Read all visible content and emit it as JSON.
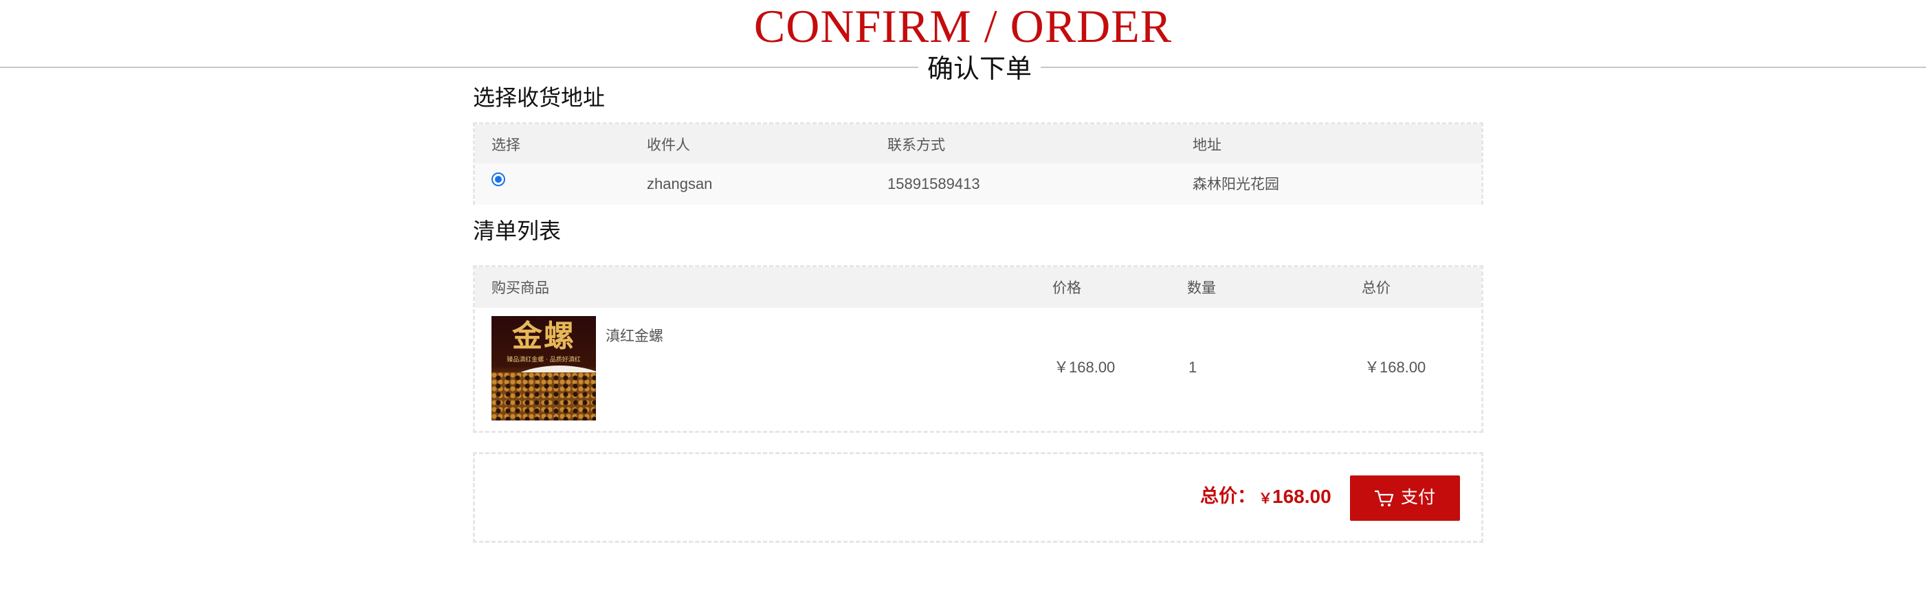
{
  "header": {
    "title_en": "CONFIRM / ORDER",
    "title_cn": "确认下单"
  },
  "address_section": {
    "title": "选择收货地址",
    "columns": [
      "选择",
      "收件人",
      "联系方式",
      "地址"
    ],
    "rows": [
      {
        "selected": true,
        "recipient": "zhangsan",
        "phone": "15891589413",
        "address": "森林阳光花园"
      }
    ]
  },
  "order_list": {
    "title": "清单列表",
    "columns": [
      "购买商品",
      "价格",
      "数量",
      "总价"
    ],
    "items": [
      {
        "name": "滇红金螺",
        "image_text": "金螺",
        "image_subtext": "臻品滇红金螺 · 品质好滇红",
        "price": "￥168.00",
        "quantity": "1",
        "subtotal": "￥168.00"
      }
    ]
  },
  "summary": {
    "total_label": "总价：",
    "currency": "￥",
    "total_amount": "168.00",
    "pay_button_label": "支付",
    "pay_icon": "cart-icon"
  },
  "colors": {
    "accent": "#c40c0c",
    "header_bg": "#f2f2f2",
    "radio": "#1a73e8"
  }
}
